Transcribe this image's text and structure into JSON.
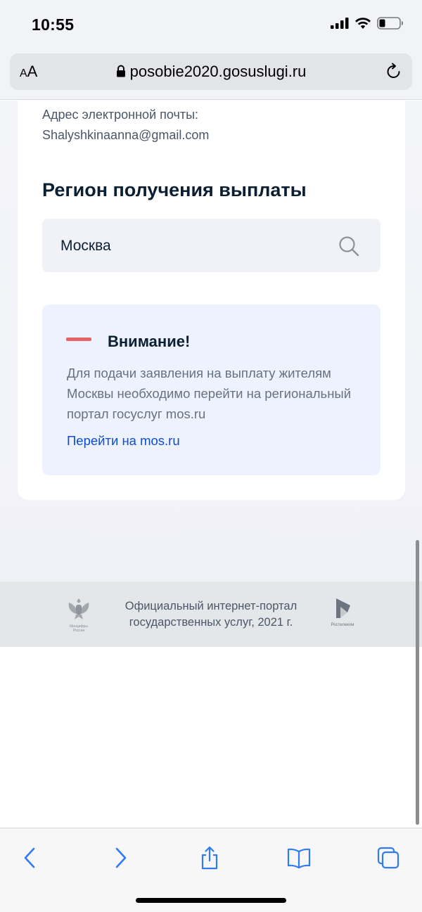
{
  "status_bar": {
    "time": "10:55",
    "icons": [
      "signal-icon",
      "wifi-icon",
      "battery-icon"
    ]
  },
  "browser": {
    "text_size_label_small": "A",
    "text_size_label_large": "A",
    "url": "posobie2020.gosuslugi.ru",
    "icons": [
      "lock-icon",
      "reload-icon"
    ]
  },
  "profile": {
    "email_label": "Адрес электронной почты:",
    "email_value": "Shalyshkinaanna@gmail.com"
  },
  "region": {
    "title": "Регион получения выплаты",
    "search_value": "Москва"
  },
  "notice": {
    "title": "Внимание!",
    "text": "Для подачи заявления на выплату жителям Москвы необходимо перейти на региональный портал госуслуг mos.ru",
    "link": "Перейти на mos.ru",
    "accent_color": "#e26464"
  },
  "footer": {
    "line1": "Официальный интернет-портал",
    "line2": "государственных услуг, 2021 г.",
    "left_logo_caption1": "Минцифры",
    "left_logo_caption2": "России",
    "right_logo_caption": "Ростелеком"
  },
  "toolbar": {
    "buttons": [
      "back-icon",
      "forward-icon",
      "share-icon",
      "bookmarks-icon",
      "tabs-icon"
    ]
  },
  "colors": {
    "link": "#0d4cd3",
    "heading": "#0b1f33",
    "notice_bg": "#edf2fe"
  }
}
